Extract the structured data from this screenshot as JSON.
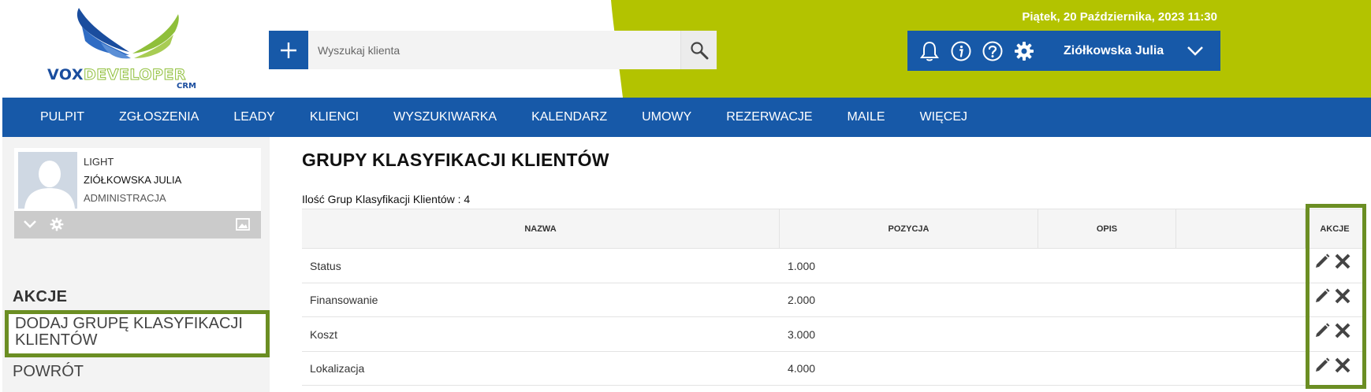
{
  "header": {
    "logo_text_part1": "VOX",
    "logo_text_part2": "DEVELOPER",
    "logo_sub": "CRM",
    "add_button_label": "+",
    "search": {
      "placeholder": "Wyszukaj klienta",
      "value": ""
    },
    "datetime": "Piątek, 20 Października, 2023   11:30",
    "user_name": "Ziółkowska Julia",
    "icons": [
      "bell-icon",
      "info-icon",
      "help-icon",
      "gear-icon",
      "chevron-down-icon"
    ],
    "colors": {
      "brand_blue": "#1759a8",
      "accent_green": "#b3c300",
      "highlight_green": "#6b8e23"
    }
  },
  "nav": {
    "items": [
      "PULPIT",
      "ZGŁOSZENIA",
      "LEADY",
      "KLIENCI",
      "WYSZUKIWARKA",
      "KALENDARZ",
      "UMOWY",
      "REZERWACJE",
      "MAILE",
      "WIĘCEJ"
    ]
  },
  "sidebar": {
    "profile": {
      "plan": "LIGHT",
      "name": "ZIÓŁKOWSKA JULIA",
      "role": "ADMINISTRACJA"
    },
    "actions_title": "AKCJE",
    "add_group_label": "DODAJ GRUPĘ KLASYFIKACJI KLIENTÓW",
    "back_label": "POWRÓT"
  },
  "main": {
    "title": "GRUPY KLASYFIKACJI KLIENTÓW",
    "count_label": "Ilość Grup Klasyfikacji Klientów : 4",
    "table": {
      "headers": [
        "NAZWA",
        "POZYCJA",
        "OPIS",
        "AKCJE"
      ],
      "rows": [
        {
          "name": "Status",
          "position": "1.000",
          "description": ""
        },
        {
          "name": "Finansowanie",
          "position": "2.000",
          "description": ""
        },
        {
          "name": "Koszt",
          "position": "3.000",
          "description": ""
        },
        {
          "name": "Lokalizacja",
          "position": "4.000",
          "description": ""
        }
      ],
      "row_action_icons": [
        "pencil-icon",
        "close-icon"
      ]
    }
  }
}
